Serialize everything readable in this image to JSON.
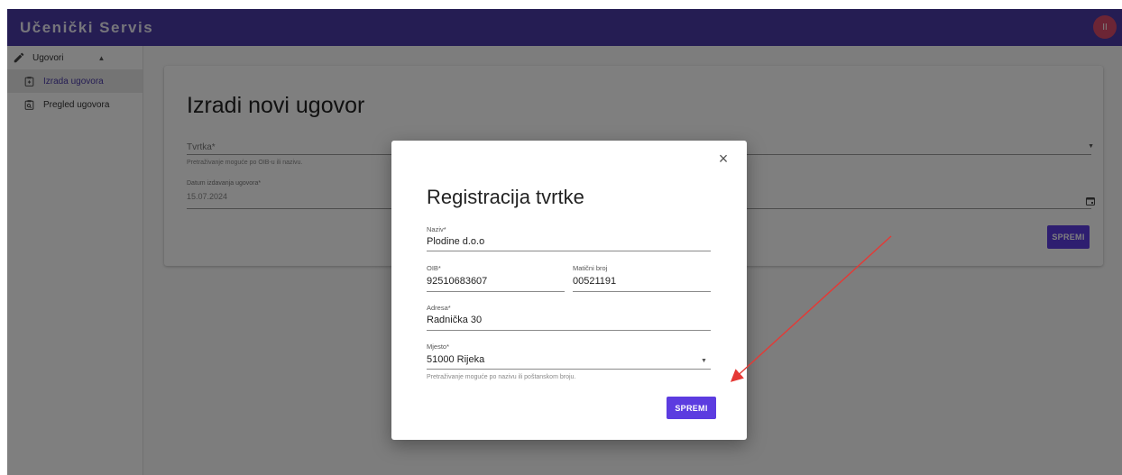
{
  "app": {
    "title": "Učenički Servis",
    "avatar_initials": "II"
  },
  "sidebar": {
    "group_label": "Ugovori",
    "items": [
      {
        "label": "Izrada ugovora",
        "active": true
      },
      {
        "label": "Pregled ugovora",
        "active": false
      }
    ]
  },
  "main": {
    "title": "Izradi novi ugovor",
    "company_field": {
      "label": "Tvrtka*",
      "help": "Pretraživanje moguće po OIB-u ili nazivu."
    },
    "date_field": {
      "label": "Datum izdavanja ugovora*",
      "value": "15.07.2024"
    },
    "save_label": "SPREMI"
  },
  "modal": {
    "title": "Registracija tvrtke",
    "close_symbol": "×",
    "fields": {
      "naziv": {
        "label": "Naziv*",
        "value": "Plodine d.o.o"
      },
      "oib": {
        "label": "OIB*",
        "value": "92510683607"
      },
      "maticni": {
        "label": "Matični broj",
        "value": "00521191"
      },
      "adresa": {
        "label": "Adresa*",
        "value": "Radnička 30"
      },
      "mjesto": {
        "label": "Mjesto*",
        "value": "51000 Rijeka",
        "help": "Pretraživanje moguće po nazivu ili poštanskom broju."
      }
    },
    "save_label": "SPREMI"
  },
  "colors": {
    "primary": "#4a3aa7",
    "button": "#5c3ce0",
    "annotation_arrow": "#e53935"
  }
}
